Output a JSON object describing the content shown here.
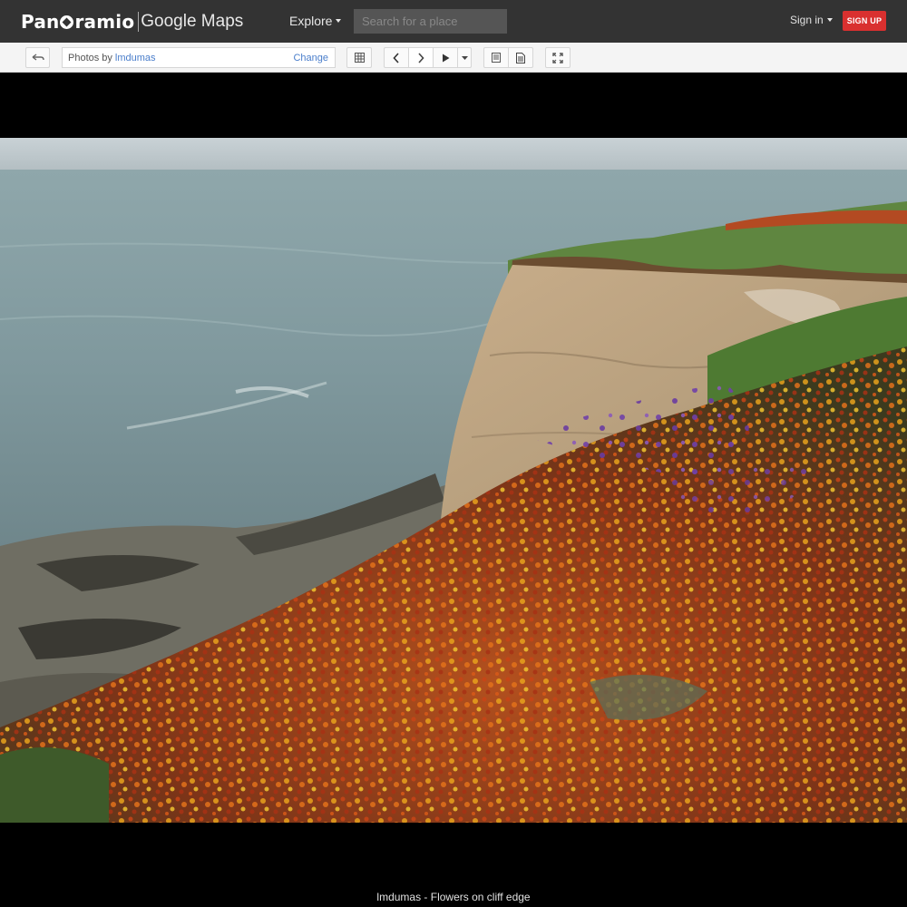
{
  "header": {
    "logo_brand": "Panoramio",
    "logo_brand_left": "Pan",
    "logo_brand_right": "ramio",
    "logo_product": "Google Maps",
    "explore_label": "Explore",
    "search_placeholder": "Search for a place",
    "signin_label": "Sign in",
    "signup_label": "SIGN UP",
    "colors": {
      "bar": "#333333",
      "signup": "#d9302f"
    }
  },
  "toolbar": {
    "photos_by_prefix": "Photos by",
    "author": "lmdumas",
    "change_label": "Change",
    "icons": [
      "back-arrow-icon",
      "grid-icon",
      "chevron-left-icon",
      "chevron-right-icon",
      "play-icon",
      "caret-down-icon",
      "info-panel-icon",
      "document-icon",
      "fullscreen-icon"
    ],
    "link_color": "#4a7ecb"
  },
  "photo": {
    "caption": "lmdumas - Flowers on cliff edge"
  }
}
